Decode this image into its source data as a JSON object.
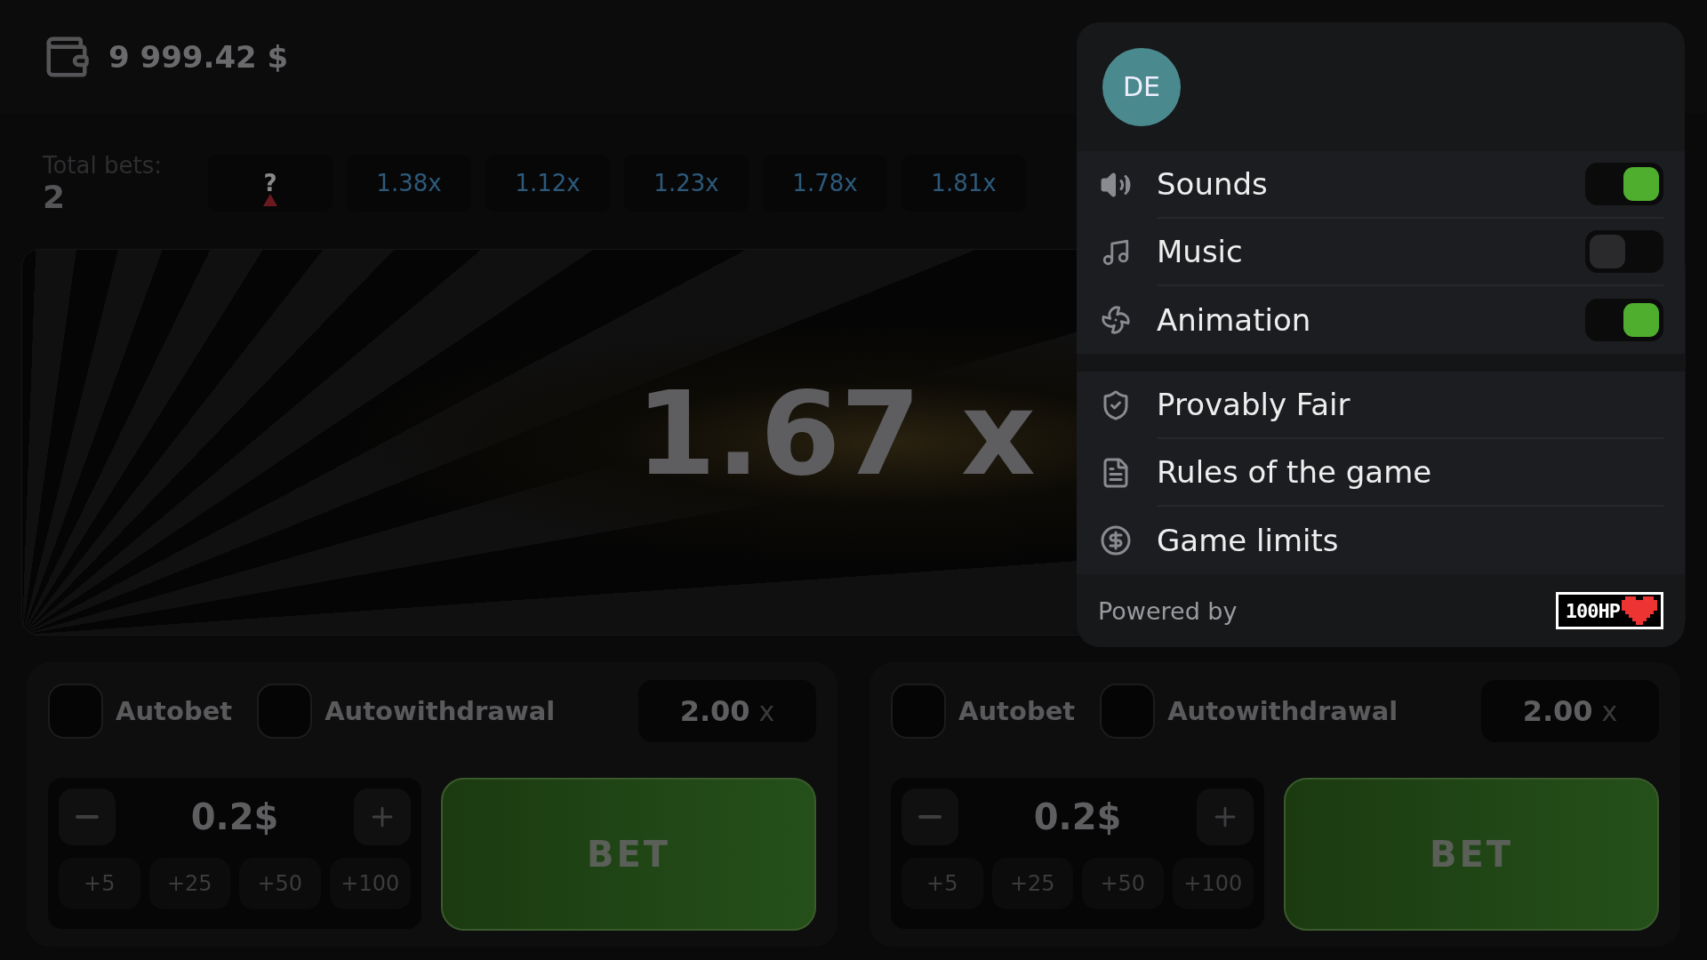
{
  "balance": "9 999.42 $",
  "total_bets": {
    "label": "Total bets:",
    "value": "2"
  },
  "history": [
    {
      "value": "?",
      "kind": "pending"
    },
    {
      "value": "1.38x",
      "kind": "past"
    },
    {
      "value": "1.12x",
      "kind": "past"
    },
    {
      "value": "1.23x",
      "kind": "past"
    },
    {
      "value": "1.78x",
      "kind": "past"
    },
    {
      "value": "1.81x",
      "kind": "past"
    }
  ],
  "game": {
    "multiplier": "1.67 x"
  },
  "bet_panels": [
    {
      "autobet": {
        "label": "Autobet",
        "checked": false
      },
      "autowithdrawal": {
        "label": "Autowithdrawal",
        "checked": false
      },
      "cashout": {
        "value": "2.00",
        "unit": "x"
      },
      "amount": "0.2$",
      "quick_adds": [
        "+5",
        "+25",
        "+50",
        "+100"
      ],
      "bet_button": "BET"
    },
    {
      "autobet": {
        "label": "Autobet",
        "checked": false
      },
      "autowithdrawal": {
        "label": "Autowithdrawal",
        "checked": false
      },
      "cashout": {
        "value": "2.00",
        "unit": "x"
      },
      "amount": "0.2$",
      "quick_adds": [
        "+5",
        "+25",
        "+50",
        "+100"
      ],
      "bet_button": "BET"
    }
  ],
  "menu": {
    "avatar": "DE",
    "settings": [
      {
        "label": "Sounds",
        "on": true
      },
      {
        "label": "Music",
        "on": false
      },
      {
        "label": "Animation",
        "on": true
      }
    ],
    "links": [
      {
        "label": "Provably Fair"
      },
      {
        "label": "Rules of the game"
      },
      {
        "label": "Game limits"
      }
    ],
    "footer": {
      "label": "Powered by",
      "logo": "100HP"
    }
  }
}
